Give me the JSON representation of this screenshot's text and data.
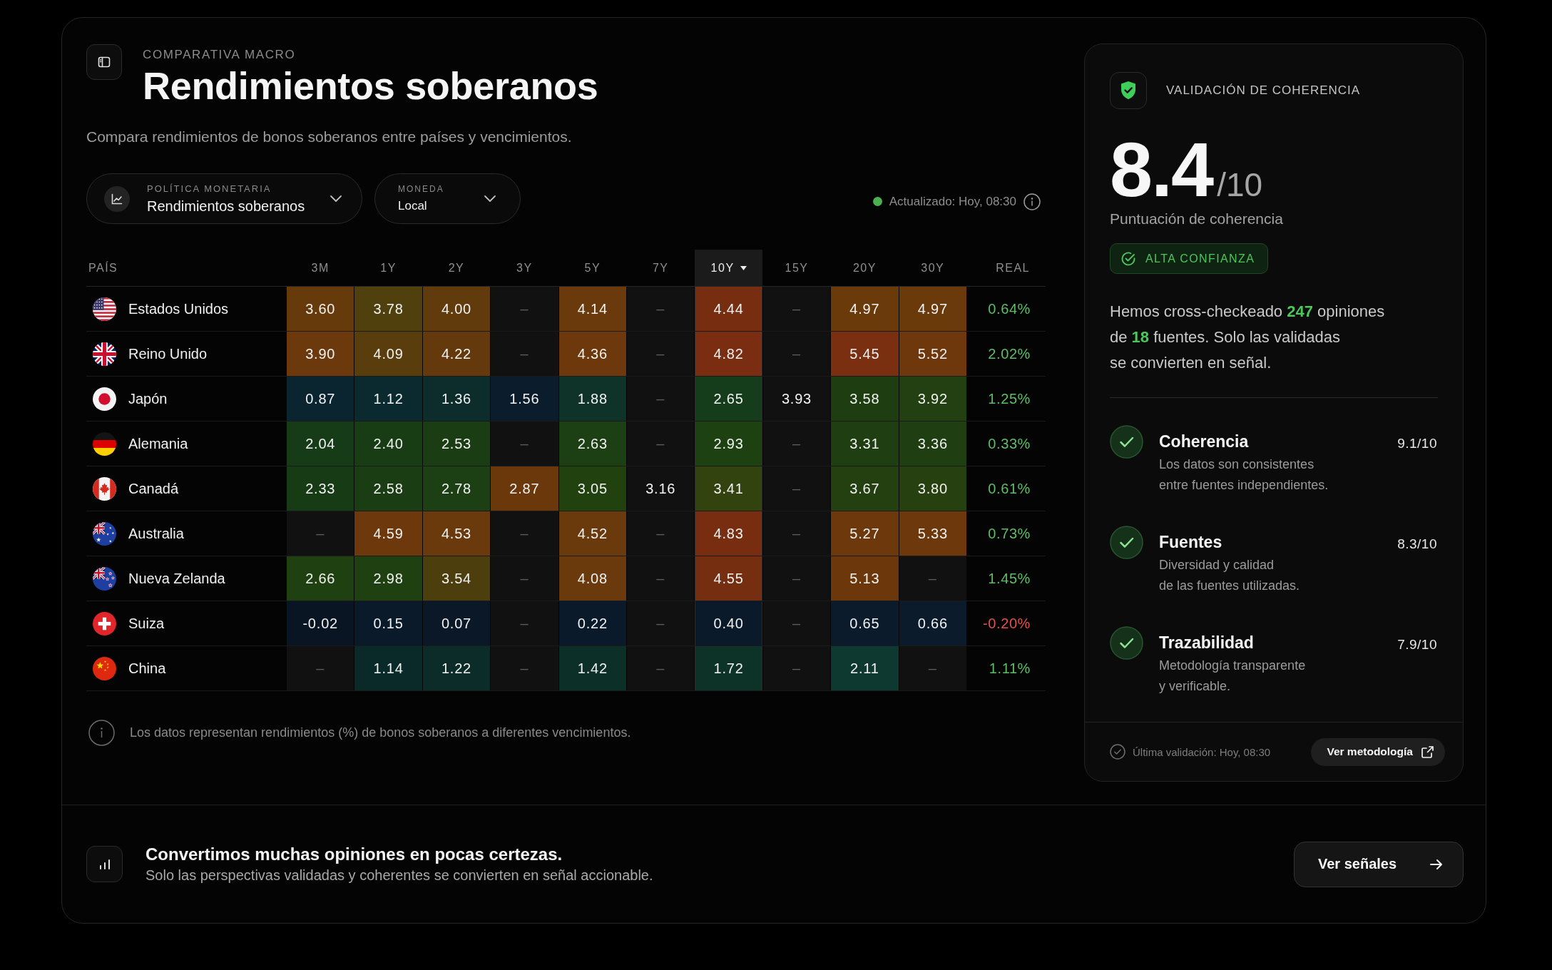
{
  "header": {
    "eyebrow": "COMPARATIVA MACRO",
    "title": "Rendimientos soberanos",
    "description": "Compara rendimientos de bonos soberanos entre países y vencimientos."
  },
  "filters": [
    {
      "kind": "icon",
      "label": "POLÍTICA MONETARIA",
      "value": "Rendimientos soberanos"
    },
    {
      "kind": "plain",
      "label": "MONEDA",
      "value": "Local"
    }
  ],
  "status": {
    "text": "Actualizado: Hoy, 08:30"
  },
  "table": {
    "country_header": "PAÍS",
    "columns": [
      {
        "label": "3M",
        "selected": false
      },
      {
        "label": "1Y",
        "selected": false
      },
      {
        "label": "2Y",
        "selected": false
      },
      {
        "label": "3Y",
        "selected": false
      },
      {
        "label": "5Y",
        "selected": false
      },
      {
        "label": "7Y",
        "selected": false
      },
      {
        "label": "10Y",
        "selected": true
      },
      {
        "label": "15Y",
        "selected": false
      },
      {
        "label": "20Y",
        "selected": false
      },
      {
        "label": "30Y",
        "selected": false
      }
    ],
    "real_header": "REAL",
    "rows": [
      {
        "kind": "us",
        "country": "Estados Unidos",
        "cells": [
          {
            "kind": "value",
            "text": "3.60",
            "color": "#673a0b"
          },
          {
            "kind": "value",
            "text": "3.78",
            "color": "#4f400d"
          },
          {
            "kind": "value",
            "text": "4.00",
            "color": "#623b0c"
          },
          {
            "kind": "empty",
            "text": "–"
          },
          {
            "kind": "value",
            "text": "4.14",
            "color": "#6a3a0c"
          },
          {
            "kind": "empty",
            "text": "–"
          },
          {
            "kind": "value",
            "text": "4.44",
            "color": "#772e10"
          },
          {
            "kind": "empty",
            "text": "–"
          },
          {
            "kind": "value",
            "text": "4.97",
            "color": "#6b3a0b"
          },
          {
            "kind": "value",
            "text": "4.97",
            "color": "#6b3a0b"
          }
        ],
        "real": {
          "text": "0.64%",
          "color": "#5cbf66"
        }
      },
      {
        "kind": "gb",
        "country": "Reino Unido",
        "cells": [
          {
            "kind": "value",
            "text": "3.90",
            "color": "#6c390c"
          },
          {
            "kind": "value",
            "text": "4.09",
            "color": "#5a3d0c"
          },
          {
            "kind": "value",
            "text": "4.22",
            "color": "#643a0c"
          },
          {
            "kind": "empty",
            "text": "–"
          },
          {
            "kind": "value",
            "text": "4.36",
            "color": "#6d380c"
          },
          {
            "kind": "empty",
            "text": "–"
          },
          {
            "kind": "value",
            "text": "4.82",
            "color": "#7a2d10"
          },
          {
            "kind": "empty",
            "text": "–"
          },
          {
            "kind": "value",
            "text": "5.45",
            "color": "#7a2f10"
          },
          {
            "kind": "value",
            "text": "5.52",
            "color": "#6e370c"
          }
        ],
        "real": {
          "text": "2.02%",
          "color": "#5cbf66"
        }
      },
      {
        "kind": "jp",
        "country": "Japón",
        "cells": [
          {
            "kind": "value",
            "text": "0.87",
            "color": "#0b2530"
          },
          {
            "kind": "value",
            "text": "1.12",
            "color": "#0b2a2f"
          },
          {
            "kind": "value",
            "text": "1.36",
            "color": "#0c2d2b"
          },
          {
            "kind": "value",
            "text": "1.56",
            "color": "#0b1c2c"
          },
          {
            "kind": "value",
            "text": "1.88",
            "color": "#0f3329"
          },
          {
            "kind": "empty",
            "text": "–"
          },
          {
            "kind": "value",
            "text": "2.65",
            "color": "#153d1b"
          },
          {
            "kind": "value",
            "text": "3.93"
          },
          {
            "kind": "value",
            "text": "3.58",
            "color": "#1e3e12"
          },
          {
            "kind": "value",
            "text": "3.92",
            "color": "#224012"
          }
        ],
        "real": {
          "text": "1.25%",
          "color": "#5cbf66"
        }
      },
      {
        "kind": "de",
        "country": "Alemania",
        "cells": [
          {
            "kind": "value",
            "text": "2.04",
            "color": "#163b17"
          },
          {
            "kind": "value",
            "text": "2.40",
            "color": "#183d15"
          },
          {
            "kind": "value",
            "text": "2.53",
            "color": "#1a3d14"
          },
          {
            "kind": "empty",
            "text": "–"
          },
          {
            "kind": "value",
            "text": "2.63",
            "color": "#1c3f13"
          },
          {
            "kind": "empty",
            "text": "–"
          },
          {
            "kind": "value",
            "text": "2.93",
            "color": "#1e4112"
          },
          {
            "kind": "empty",
            "text": "–"
          },
          {
            "kind": "value",
            "text": "3.31",
            "color": "#1f3f12"
          },
          {
            "kind": "value",
            "text": "3.36",
            "color": "#1f3f12"
          }
        ],
        "real": {
          "text": "0.33%",
          "color": "#5cbf66"
        }
      },
      {
        "kind": "ca",
        "country": "Canadá",
        "cells": [
          {
            "kind": "value",
            "text": "2.33",
            "color": "#173c15"
          },
          {
            "kind": "value",
            "text": "2.58",
            "color": "#1a3d14"
          },
          {
            "kind": "value",
            "text": "2.78",
            "color": "#1c3f13"
          },
          {
            "kind": "value",
            "text": "2.87",
            "color": "#6a380b"
          },
          {
            "kind": "value",
            "text": "3.05",
            "color": "#21410f"
          },
          {
            "kind": "value",
            "text": "3.16"
          },
          {
            "kind": "value",
            "text": "3.41",
            "color": "#33430f"
          },
          {
            "kind": "empty",
            "text": "–"
          },
          {
            "kind": "value",
            "text": "3.67",
            "color": "#243f10"
          },
          {
            "kind": "value",
            "text": "3.80",
            "color": "#264010"
          }
        ],
        "real": {
          "text": "0.61%",
          "color": "#5cbf66"
        }
      },
      {
        "kind": "au",
        "country": "Australia",
        "cells": [
          {
            "kind": "empty",
            "text": "–"
          },
          {
            "kind": "value",
            "text": "4.59",
            "color": "#6d380c"
          },
          {
            "kind": "value",
            "text": "4.53",
            "color": "#6a390c"
          },
          {
            "kind": "empty",
            "text": "–"
          },
          {
            "kind": "value",
            "text": "4.52",
            "color": "#6a390c"
          },
          {
            "kind": "empty",
            "text": "–"
          },
          {
            "kind": "value",
            "text": "4.83",
            "color": "#782d10"
          },
          {
            "kind": "empty",
            "text": "–"
          },
          {
            "kind": "value",
            "text": "5.27",
            "color": "#6d380c"
          },
          {
            "kind": "value",
            "text": "5.33",
            "color": "#6d380c"
          }
        ],
        "real": {
          "text": "0.73%",
          "color": "#5cbf66"
        }
      },
      {
        "kind": "nz",
        "country": "Nueva Zelanda",
        "cells": [
          {
            "kind": "value",
            "text": "2.66",
            "color": "#1f4112"
          },
          {
            "kind": "value",
            "text": "2.98",
            "color": "#1f4112"
          },
          {
            "kind": "value",
            "text": "3.54",
            "color": "#4c3f0d"
          },
          {
            "kind": "empty",
            "text": "–"
          },
          {
            "kind": "value",
            "text": "4.08",
            "color": "#6a3a0c"
          },
          {
            "kind": "empty",
            "text": "–"
          },
          {
            "kind": "value",
            "text": "4.55",
            "color": "#762e10"
          },
          {
            "kind": "empty",
            "text": "–"
          },
          {
            "kind": "value",
            "text": "5.13",
            "color": "#6c370b"
          },
          {
            "kind": "empty",
            "text": "–"
          }
        ],
        "real": {
          "text": "1.45%",
          "color": "#5cbf66"
        }
      },
      {
        "kind": "ch",
        "country": "Suiza",
        "cells": [
          {
            "kind": "value",
            "text": "-0.02",
            "color": "#0a1524"
          },
          {
            "kind": "value",
            "text": "0.15",
            "color": "#0b1a2a"
          },
          {
            "kind": "value",
            "text": "0.07",
            "color": "#0a1827"
          },
          {
            "kind": "empty",
            "text": "–"
          },
          {
            "kind": "value",
            "text": "0.22",
            "color": "#0b1a2b"
          },
          {
            "kind": "empty",
            "text": "–"
          },
          {
            "kind": "value",
            "text": "0.40",
            "color": "#0b1a2b"
          },
          {
            "kind": "empty",
            "text": "–"
          },
          {
            "kind": "value",
            "text": "0.65",
            "color": "#0b1b2b"
          },
          {
            "kind": "value",
            "text": "0.66",
            "color": "#0b1b2b"
          }
        ],
        "real": {
          "text": "-0.20%",
          "color": "#e0524a"
        }
      },
      {
        "kind": "cn",
        "country": "China",
        "cells": [
          {
            "kind": "empty",
            "text": "–"
          },
          {
            "kind": "value",
            "text": "1.14",
            "color": "#0a2929"
          },
          {
            "kind": "value",
            "text": "1.22",
            "color": "#0b2c29"
          },
          {
            "kind": "empty",
            "text": "–"
          },
          {
            "kind": "value",
            "text": "1.42",
            "color": "#0c2f28"
          },
          {
            "kind": "empty",
            "text": "–"
          },
          {
            "kind": "value",
            "text": "1.72",
            "color": "#0d3328"
          },
          {
            "kind": "empty",
            "text": "–"
          },
          {
            "kind": "value",
            "text": "2.11",
            "color": "#0d3930"
          },
          {
            "kind": "empty",
            "text": "–"
          }
        ],
        "real": {
          "text": "1.11%",
          "color": "#5cbf66"
        }
      }
    ]
  },
  "footnote": "Los datos representan rendimientos (%) de bonos soberanos a diferentes vencimientos.",
  "validation": {
    "title": "VALIDACIÓN DE COHERENCIA",
    "score": "8.4",
    "score_max": "/10",
    "score_label": "Puntuación de coherencia",
    "badge": "ALTA CONFIANZA",
    "summary": "Hemos cross-checkeado **247** opiniones\nde **18** fuentes. Solo las validadas\nse convierten en señal.",
    "criteria": [
      {
        "checked": true,
        "title": "Coherencia",
        "description": "Los datos son consistentes\nentre fuentes independientes.",
        "score": "9.1/10"
      },
      {
        "checked": true,
        "title": "Fuentes",
        "description": "Diversidad y calidad\nde las fuentes utilizadas.",
        "score": "8.3/10"
      },
      {
        "checked": true,
        "title": "Trazabilidad",
        "description": "Metodología transparente\ny verificable.",
        "score": "7.9/10"
      }
    ],
    "last_validation": "Última validación: Hoy, 08:30",
    "button": "Ver metodología"
  },
  "banner": {
    "title": "Convertimos muchas opiniones en pocas certezas.",
    "subtitle": "Solo las perspectivas validadas y coherentes se convierten en señal accionable.",
    "button": "Ver señales"
  }
}
